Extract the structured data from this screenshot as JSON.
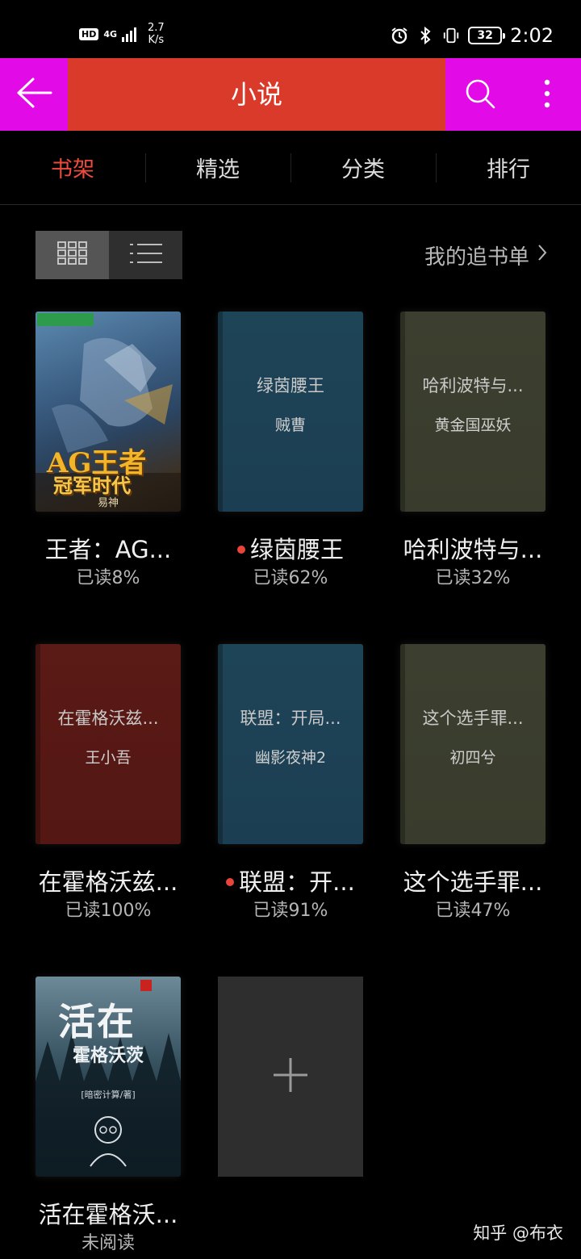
{
  "status_bar": {
    "hd": "HD",
    "network": "4G",
    "speed_value": "2.7",
    "speed_unit": "K/s",
    "battery": "32",
    "time": "2:02"
  },
  "app_bar": {
    "title": "小说",
    "colors": {
      "bar": "#d93a2a",
      "edge_zones": "#e20ae6"
    },
    "icons": [
      "back-arrow-icon",
      "search-icon",
      "more-vertical-icon"
    ]
  },
  "tabs": [
    {
      "label": "书架",
      "active": true
    },
    {
      "label": "精选",
      "active": false
    },
    {
      "label": "分类",
      "active": false
    },
    {
      "label": "排行",
      "active": false
    }
  ],
  "toolbar": {
    "view_modes": [
      "grid-view-icon",
      "list-view-icon"
    ],
    "active_view": "grid",
    "my_list_label": "我的追书单"
  },
  "books": [
    {
      "cover_type": "image",
      "title": "王者：AG...",
      "progress": "已读8%",
      "new_update": false,
      "cover_text": {
        "title": "AG王者",
        "subtitle": "冠军时代",
        "author": "易神"
      }
    },
    {
      "cover_type": "blue",
      "title": "绿茵腰王",
      "progress": "已读62%",
      "new_update": true,
      "cover_text": {
        "title": "绿茵腰王",
        "author": "贼曹"
      }
    },
    {
      "cover_type": "olive",
      "title": "哈利波特与...",
      "progress": "已读32%",
      "new_update": false,
      "cover_text": {
        "title": "哈利波特与...",
        "author": "黄金国巫妖"
      }
    },
    {
      "cover_type": "red",
      "title": "在霍格沃兹...",
      "progress": "已读100%",
      "new_update": false,
      "cover_text": {
        "title": "在霍格沃兹...",
        "author": "王小吾"
      }
    },
    {
      "cover_type": "blue",
      "title": "联盟：开...",
      "progress": "已读91%",
      "new_update": true,
      "cover_text": {
        "title": "联盟：开局...",
        "author": "幽影夜神2"
      }
    },
    {
      "cover_type": "olive",
      "title": "这个选手罪...",
      "progress": "已读47%",
      "new_update": false,
      "cover_text": {
        "title": "这个选手罪...",
        "author": "初四兮"
      }
    },
    {
      "cover_type": "image",
      "title": "活在霍格沃...",
      "progress": "未阅读",
      "new_update": false,
      "cover_text": {
        "title": "活在",
        "subtitle": "霍格沃茨",
        "author": "[暗密计算/著]"
      }
    }
  ],
  "add_book": {
    "icon": "plus-icon"
  },
  "watermark": "知乎 @布衣"
}
